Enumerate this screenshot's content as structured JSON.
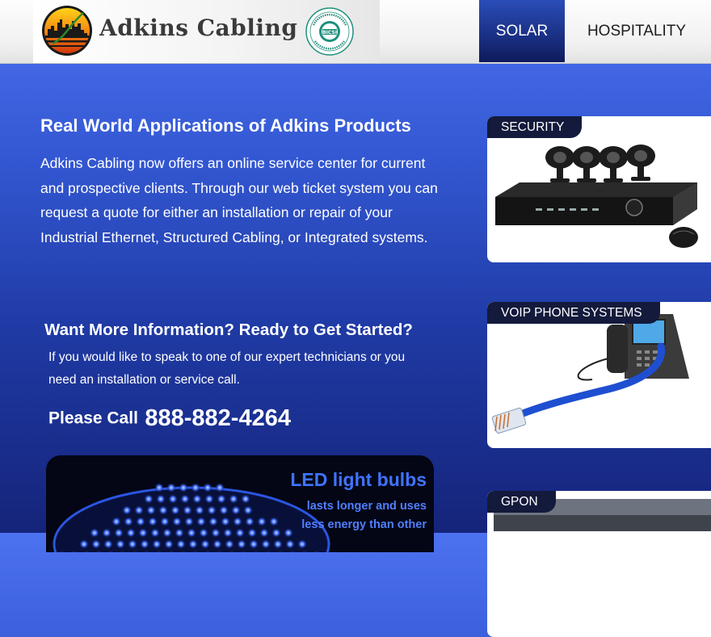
{
  "header": {
    "brand_name": "Adkins Cabling",
    "nav": [
      {
        "label": "SOLAR",
        "active": true
      },
      {
        "label": "HOSPITALITY",
        "active": false
      }
    ]
  },
  "main": {
    "heading": "Real World Applications of Adkins Products",
    "intro": "Adkins Cabling now offers an online service center for current and prospective clients. Through our web ticket system you can request a quote for either an installation or repair of your Industrial Ethernet, Structured Cabling, or Integrated systems.",
    "info_heading": "Want More Information? Ready to Get Started?",
    "info_text": "If you would like to speak to one of our expert technicians or you need an installation or service call.",
    "call_label": "Please Call",
    "phone": "888-882-4264"
  },
  "promo": {
    "title": "LED light bulbs",
    "line1": "lasts longer and uses",
    "line2": "less energy than other"
  },
  "cards": [
    {
      "label": "SECURITY",
      "image": "security-camera-dvr"
    },
    {
      "label": "VOIP PHONE SYSTEMS",
      "image": "ip-phone-ethernet-cable"
    },
    {
      "label": "GPON",
      "image": "gpon-equipment"
    }
  ],
  "colors": {
    "page_gradient_top": "#4d72f0",
    "page_gradient_bottom": "#15247a",
    "nav_active": "#1a2f83",
    "card_label_bg": "#131a3c",
    "led_text": "#3e74ff"
  }
}
